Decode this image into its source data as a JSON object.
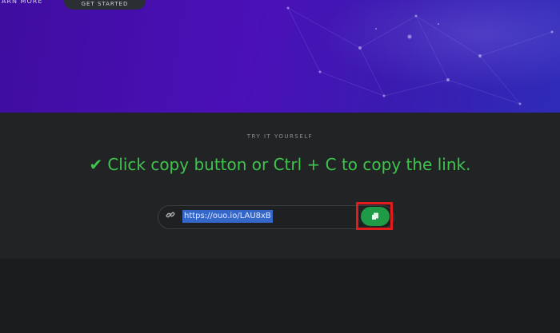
{
  "hero": {
    "learn_more_label": "ARN MORE",
    "get_started_label": "GET STARTED"
  },
  "section": {
    "eyebrow": "TRY IT YOURSELF",
    "headline": "Click copy button or Ctrl + C to copy the link.",
    "headline_check": "✔"
  },
  "shortener": {
    "link_value": "https://ouo.io/LAU8xB",
    "link_icon": "link-icon",
    "copy_icon": "copy-icon"
  },
  "colors": {
    "hero_purple": "#4b10b8",
    "accent_green": "#3fc44e",
    "copy_button_green": "#1f9a46",
    "highlight_red": "#e01c1c",
    "selection_blue": "#3567c8"
  }
}
